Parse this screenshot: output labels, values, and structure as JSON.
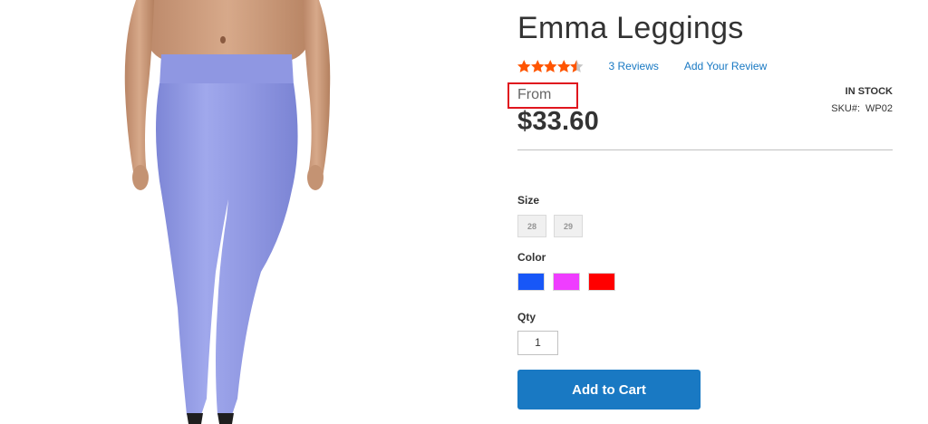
{
  "product": {
    "name": "Emma Leggings",
    "rating_stars": 4.5,
    "reviews_link": "3  Reviews",
    "add_review_link": "Add Your Review",
    "price_prefix": "From",
    "price": "$33.60",
    "stock_status": "IN STOCK",
    "sku_label": "SKU#:",
    "sku_value": "WP02",
    "image_subject": "woman wearing lavender leggings"
  },
  "options": {
    "size_label": "Size",
    "sizes": [
      "28",
      "29"
    ],
    "color_label": "Color",
    "colors": [
      {
        "name": "Blue",
        "hex": "#1857f7"
      },
      {
        "name": "Purple",
        "hex": "#ef3dff"
      },
      {
        "name": "Red",
        "hex": "#ff0000"
      }
    ]
  },
  "qty": {
    "label": "Qty",
    "value": "1"
  },
  "actions": {
    "add_to_cart": "Add to Cart"
  },
  "colors": {
    "accent": "#1979c3",
    "star": "#ff5501",
    "highlight": "#e0161e",
    "leggings": "#8f97e0"
  }
}
